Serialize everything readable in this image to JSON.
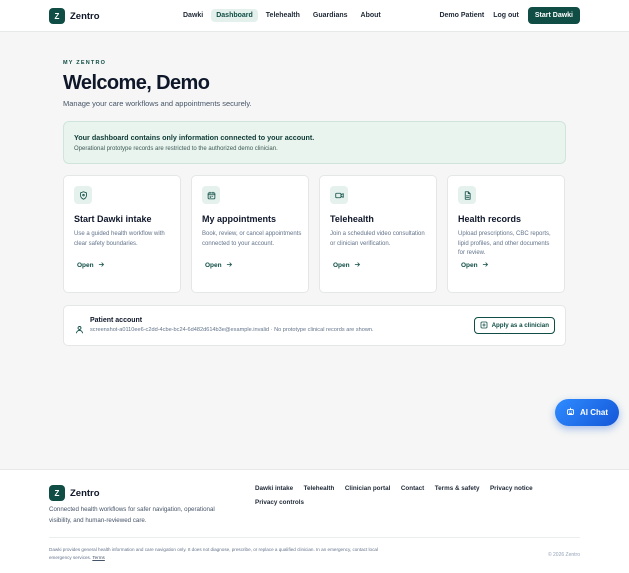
{
  "header": {
    "logo_letter": "Z",
    "brand": "Zentro",
    "nav": [
      "Dawki",
      "Dashboard",
      "Telehealth",
      "Guardians",
      "About"
    ],
    "active_nav": "Dashboard",
    "user_label": "Demo Patient",
    "logout_label": "Log out",
    "cta_label": "Start Dawki"
  },
  "hero": {
    "eyebrow": "MY ZENTRO",
    "title": "Welcome, Demo",
    "subtitle": "Manage your care workflows and appointments securely."
  },
  "banner": {
    "title": "Your dashboard contains only information connected to your account.",
    "text": "Operational prototype records are restricted to the authorized demo clinician."
  },
  "cards": [
    {
      "icon": "shield-icon",
      "title": "Start Dawki intake",
      "desc": "Use a guided health workflow with clear safety boundaries.",
      "link": "Open"
    },
    {
      "icon": "calendar-icon",
      "title": "My appointments",
      "desc": "Book, review, or cancel appointments connected to your account.",
      "link": "Open"
    },
    {
      "icon": "video-icon",
      "title": "Telehealth",
      "desc": "Join a scheduled video consultation or clinician verification.",
      "link": "Open"
    },
    {
      "icon": "document-icon",
      "title": "Health records",
      "desc": "Upload prescriptions, CBC reports, lipid profiles, and other documents for review.",
      "link": "Open"
    }
  ],
  "account": {
    "title": "Patient account",
    "meta": "screenshot-a0110ee6-c2dd-4cbe-bc24-6d482d614b3e@example.invalid · No prototype clinical records are shown.",
    "button_label": "Apply as a clinician"
  },
  "ai_chat": {
    "label": "AI Chat"
  },
  "footer": {
    "brand": "Zentro",
    "tagline": "Connected health workflows for safer navigation, operational visibility, and human-reviewed care.",
    "links": [
      "Dawki intake",
      "Telehealth",
      "Clinician portal",
      "Contact",
      "Terms & safety",
      "Privacy notice",
      "Privacy controls"
    ],
    "disclaimer": "Dawki provides general health information and care navigation only. It does not diagnose, prescribe, or replace a qualified clinician. In an emergency, contact local emergency services.",
    "terms_label": "Terms",
    "copyright": "© 2026 Zentro"
  },
  "colors": {
    "brand": "#0f4d45",
    "banner_bg": "#e9f4ef",
    "ai_chat": "#1f6fea"
  }
}
